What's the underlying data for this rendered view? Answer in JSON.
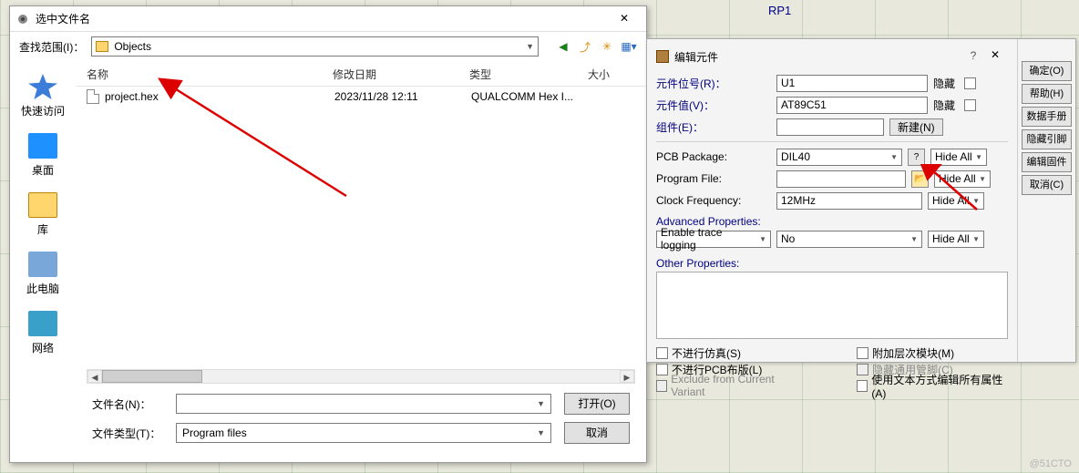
{
  "file_dialog": {
    "title": "选中文件名",
    "close_x": "✕",
    "lookup_label": "查找范围(I)：",
    "folder_name": "Objects",
    "toolbar_icons": {
      "back": "back-icon",
      "up": "up-icon",
      "new": "new-folder-icon",
      "view": "view-icon"
    },
    "places": {
      "quick": "快速访问",
      "desktop": "桌面",
      "library": "库",
      "thispc": "此电脑",
      "network": "网络"
    },
    "columns": {
      "name": "名称",
      "date": "修改日期",
      "type": "类型",
      "size": "大小"
    },
    "file": {
      "name": "project.hex",
      "date": "2023/11/28 12:11",
      "type": "QUALCOMM Hex I...",
      "size": ""
    },
    "filename_label": "文件名(N)：",
    "filename_value": "",
    "filetype_label": "文件类型(T)：",
    "filetype_value": "Program files",
    "open_btn": "打开(O)",
    "cancel_btn": "取消"
  },
  "schematic": {
    "ref": "RP1"
  },
  "prop_dialog": {
    "title": "编辑元件",
    "ref_label": "元件位号(R)：",
    "ref_value": "U1",
    "val_label": "元件值(V)：",
    "val_value": "AT89C51",
    "hide_label": "隐藏",
    "comp_label": "组件(E)：",
    "new_btn": "新建(N)",
    "pcb_label": "PCB Package:",
    "pcb_value": "DIL40",
    "prog_label": "Program File:",
    "prog_value": "",
    "clock_label": "Clock Frequency:",
    "clock_value": "12MHz",
    "adv_label": "Advanced Properties:",
    "adv_prop": "Enable trace logging",
    "adv_val": "No",
    "hideall": "Hide All",
    "other_label": "Other Properties:",
    "cb_sim": "不进行仿真(S)",
    "cb_pcb": "不进行PCB布版(L)",
    "cb_exclude": "Exclude from Current Variant",
    "cb_attach": "附加层次模块(M)",
    "cb_hidepins": "隐藏通用管脚(C)",
    "cb_textedit": "使用文本方式编辑所有属性(A)",
    "buttons": {
      "ok": "确定(O)",
      "help": "帮助(H)",
      "data": "数据手册(D)",
      "hpins": "隐藏引脚(P)",
      "editfw": "编辑固件(F)",
      "cancel": "取消(C)"
    }
  },
  "watermark": "@51CTO"
}
